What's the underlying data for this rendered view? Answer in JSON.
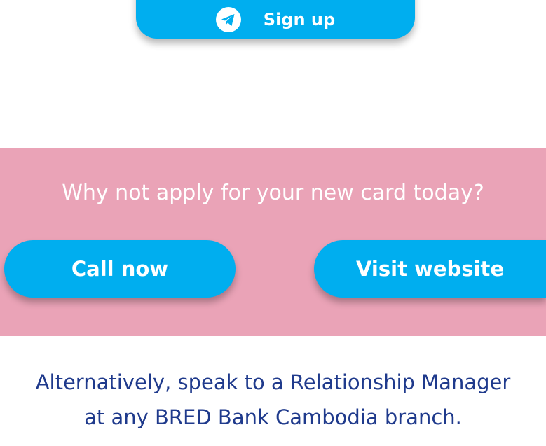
{
  "signup": {
    "label": "Sign up",
    "icon": "telegram-icon"
  },
  "banner": {
    "headline": "Why not apply for your new card today?",
    "call_label": "Call now",
    "visit_label": "Visit website",
    "background": "#eaa3b7"
  },
  "footer": {
    "line1": "Alternatively, speak to a Relationship Manager",
    "line2": "at any BRED Bank Cambodia branch."
  },
  "colors": {
    "button": "#00aeef",
    "footer_text": "#1f3a8c"
  }
}
